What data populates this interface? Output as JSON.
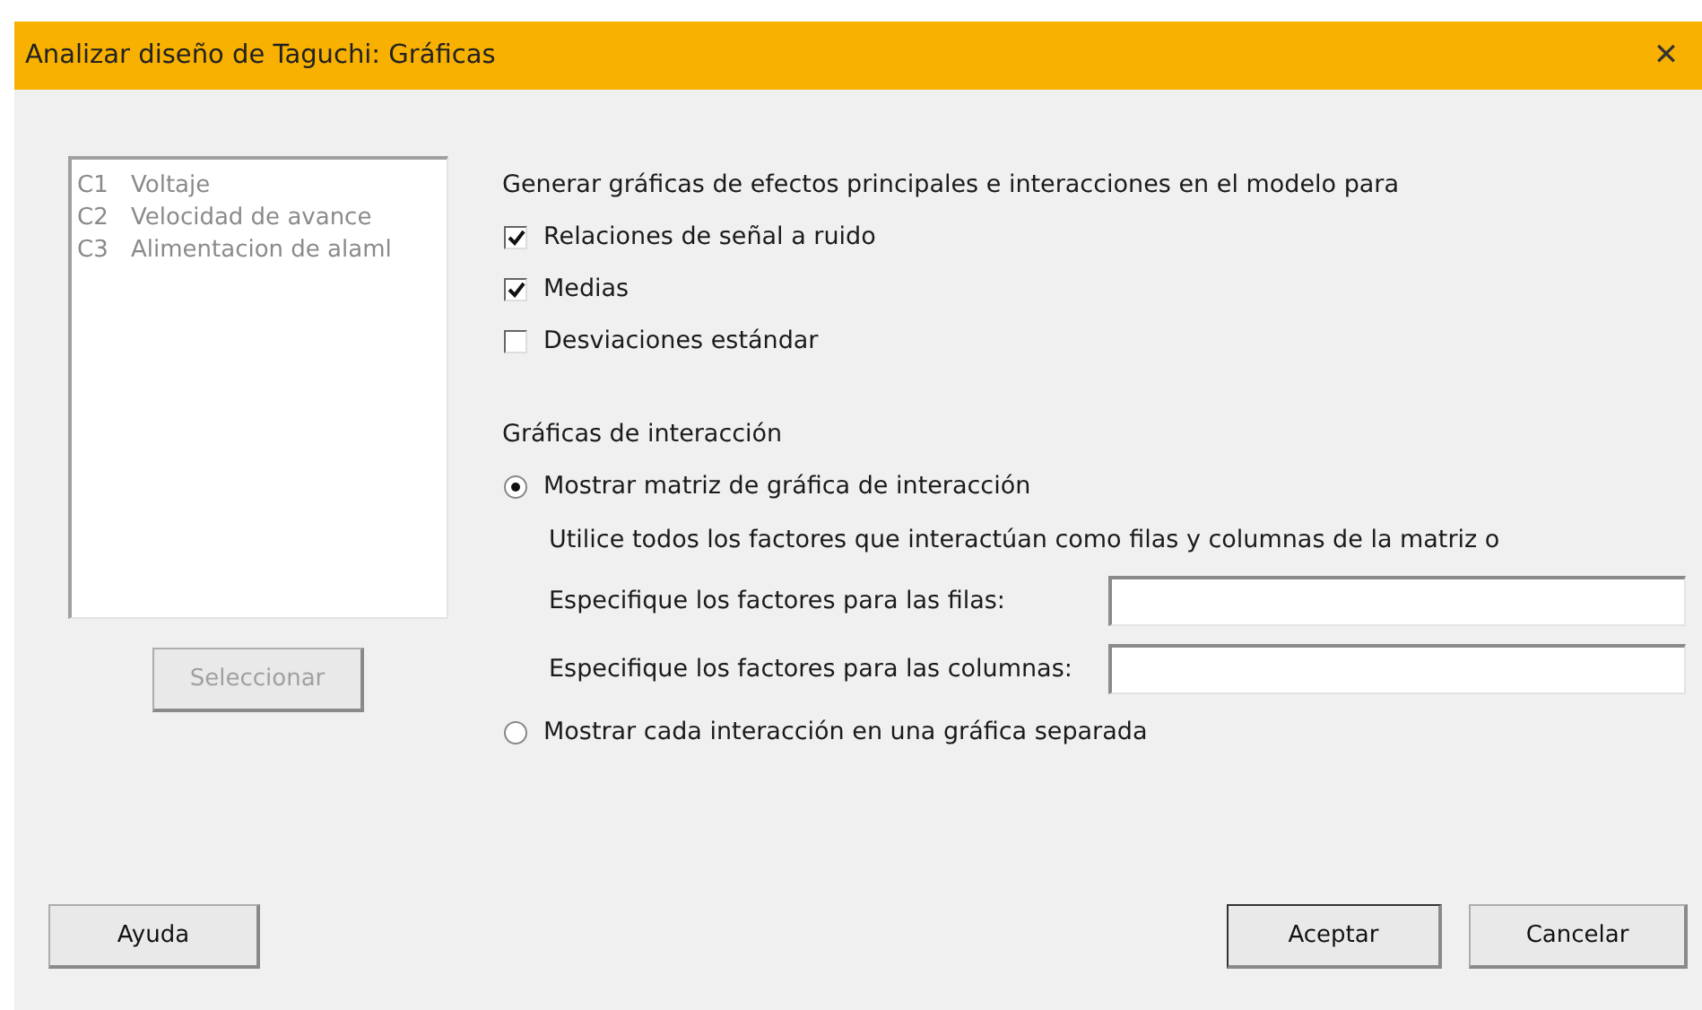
{
  "window": {
    "title": "Analizar diseño de Taguchi: Gráficas",
    "close": "✕"
  },
  "variables": [
    {
      "code": "C1",
      "name": "Voltaje"
    },
    {
      "code": "C2",
      "name": "Velocidad de avance"
    },
    {
      "code": "C3",
      "name": "Alimentacion de alaml"
    }
  ],
  "select_button": {
    "label": "Seleccionar",
    "disabled": true
  },
  "effects": {
    "heading": "Generar gráficas de efectos principales e interacciones en el modelo para",
    "options": [
      {
        "label": "Relaciones de señal a ruido",
        "checked": true
      },
      {
        "label": "Medias",
        "checked": true
      },
      {
        "label": "Desviaciones estándar",
        "checked": false
      }
    ]
  },
  "interaction": {
    "heading": "Gráficas de interacción",
    "matrix_option": {
      "label": "Mostrar matriz de gráfica de interacción",
      "selected": true
    },
    "note": "Utilice todos los factores que interactúan como filas y columnas de la matriz o",
    "fields": [
      {
        "label": "Especifique los factores para las filas:"
      },
      {
        "label": "Especifique los factores para las columnas:"
      }
    ],
    "separate_option": {
      "label": "Mostrar cada interacción en una gráfica separada",
      "selected": false
    }
  },
  "buttons": {
    "help": "Ayuda",
    "ok": "Aceptar",
    "cancel": "Cancelar"
  }
}
